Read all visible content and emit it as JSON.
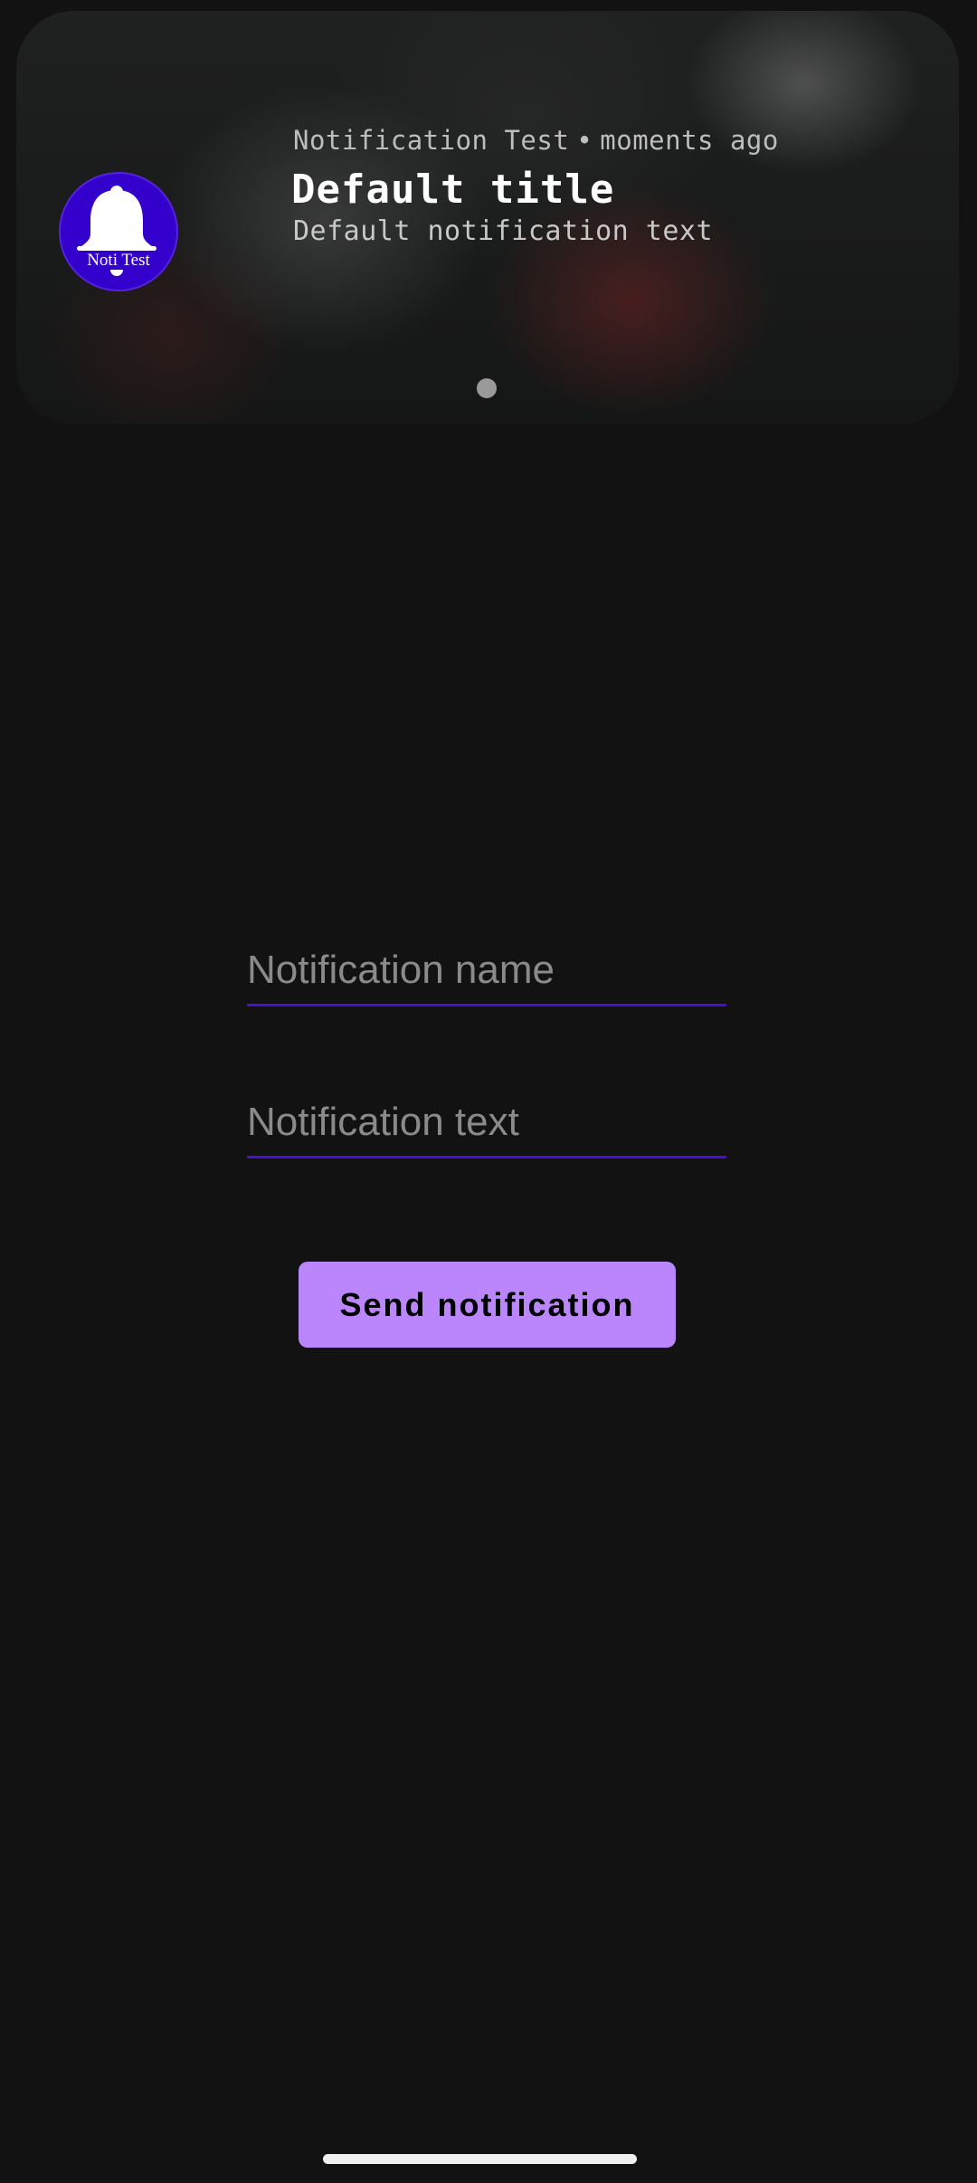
{
  "notification": {
    "app_name": "Notification Test",
    "separator": "•",
    "timestamp": "moments ago",
    "title": "Default title",
    "text": "Default notification text",
    "icon": {
      "name": "bell-icon",
      "caption": "Noti Test",
      "background": "#3300cc"
    },
    "page_indicator_count": 1
  },
  "form": {
    "name_field": {
      "value": "",
      "placeholder": "Notification name"
    },
    "text_field": {
      "value": "",
      "placeholder": "Notification text"
    },
    "send_button_label": "Send notification"
  },
  "colors": {
    "background": "#121212",
    "accent": "#bb86fc",
    "underline": "#4a0ed8",
    "icon_background": "#3300cc"
  }
}
